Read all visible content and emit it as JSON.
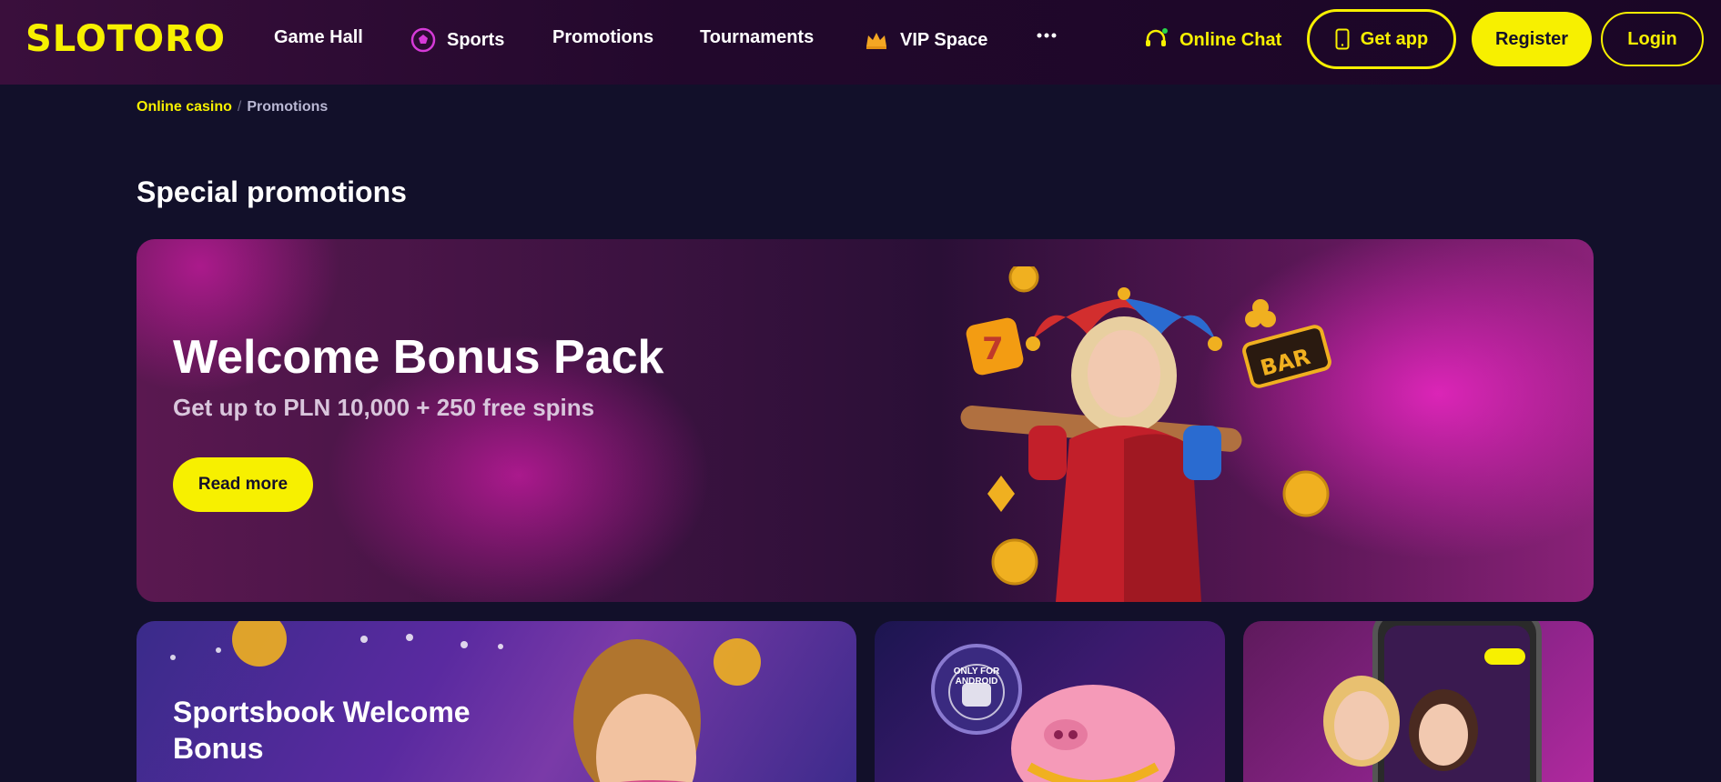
{
  "header": {
    "logo": "SLOTORO",
    "nav": [
      {
        "label": "Game Hall"
      },
      {
        "label": "Sports"
      },
      {
        "label": "Promotions"
      },
      {
        "label": "Tournaments"
      },
      {
        "label": "VIP Space"
      }
    ],
    "more_icon": "more-dots-icon",
    "chat_label": "Online Chat",
    "get_app_label": "Get app",
    "register_label": "Register",
    "login_label": "Login"
  },
  "breadcrumb": {
    "items": [
      "Online casino",
      "Promotions"
    ],
    "separator": "/"
  },
  "section_title": "Special promotions",
  "hero": {
    "title": "Welcome Bonus Pack",
    "subtitle": "Get up to PLN 10,000 + 250 free spins",
    "button": "Read more"
  },
  "cards": [
    {
      "title": "Sportsbook Welcome Bonus"
    },
    {
      "title": "",
      "badge": "ONLY FOR ANDROID"
    },
    {
      "title": ""
    }
  ],
  "colors": {
    "accent": "#f7f000",
    "background": "#12102a",
    "header": "#22082c",
    "hero_pink": "#ff28d2"
  }
}
